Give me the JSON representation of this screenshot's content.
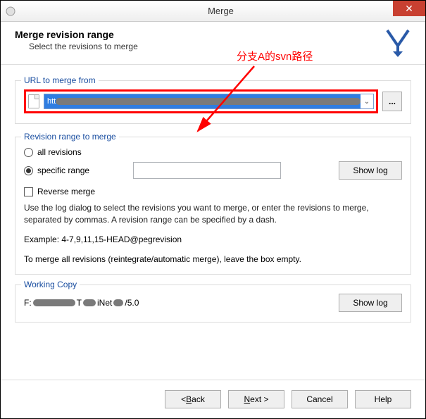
{
  "window": {
    "title": "Merge"
  },
  "header": {
    "title": "Merge revision range",
    "subtitle": "Select the revisions to merge"
  },
  "annotation": {
    "text": "分支A的svn路径"
  },
  "url_group": {
    "label": "URL to merge from",
    "value_prefix": "htt",
    "browse_label": "..."
  },
  "rev_group": {
    "label": "Revision range to merge",
    "all_label": "all revisions",
    "specific_label": "specific range",
    "specific_value": "",
    "show_log_label": "Show log",
    "reverse_label": "Reverse merge",
    "help_text": "Use the log dialog to select the revisions you want to merge, or enter the revisions to merge, separated by commas. A revision range can be specified by a dash.",
    "example_text": "Example: 4-7,9,11,15-HEAD@pegrevision",
    "empty_text": "To merge all revisions (reintegrate/automatic merge), leave the box empty."
  },
  "wc_group": {
    "label": "Working Copy",
    "path_prefix": "F:",
    "path_mid": "T",
    "path_suffix": "iNet",
    "path_tail": "/5.0",
    "show_log_label": "Show log"
  },
  "footer": {
    "back": "< Back",
    "next": "Next >",
    "cancel": "Cancel",
    "help": "Help"
  },
  "icons": {
    "close": "✕",
    "dropdown": "⌄"
  }
}
